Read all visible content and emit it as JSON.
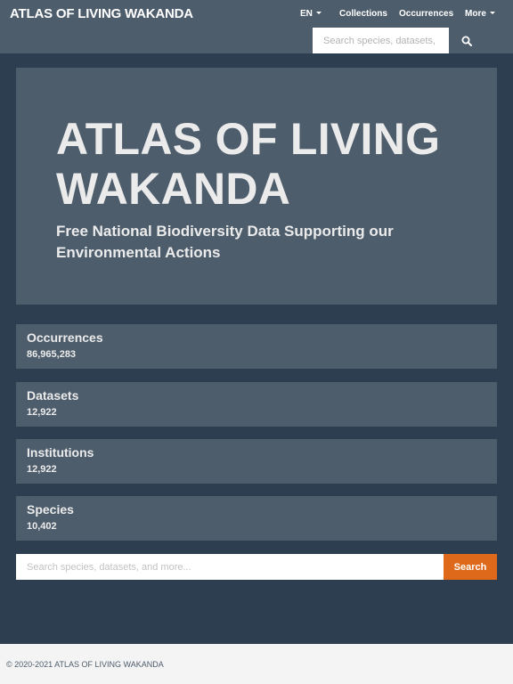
{
  "navbar": {
    "brand": "ATLAS OF LIVING WAKANDA",
    "language": "EN",
    "items": {
      "collections": "Collections",
      "occurrences": "Occurrences",
      "more": "More"
    },
    "search_placeholder": "Search species, datasets, and more..."
  },
  "hero": {
    "title": "ATLAS OF LIVING WAKANDA",
    "subtitle": "Free National Biodiversity Data Supporting our Environmental Actions"
  },
  "stats": [
    {
      "label": "Occurrences",
      "value": "86,965,283"
    },
    {
      "label": "Datasets",
      "value": "12,922"
    },
    {
      "label": "Institutions",
      "value": "12,922"
    },
    {
      "label": "Species",
      "value": "10,402"
    }
  ],
  "search": {
    "placeholder": "Search species, datasets, and more...",
    "button_label": "Search"
  },
  "footer": {
    "copyright": "© 2020-2021 ATLAS OF LIVING WAKANDA"
  },
  "colors": {
    "background": "#2c3e50",
    "panel": "#4e5d6c",
    "accent": "#df691a",
    "footer": "#f4f4f4"
  },
  "icons": {
    "search_icon": "search-icon",
    "caret_icon": "caret-down-icon"
  }
}
